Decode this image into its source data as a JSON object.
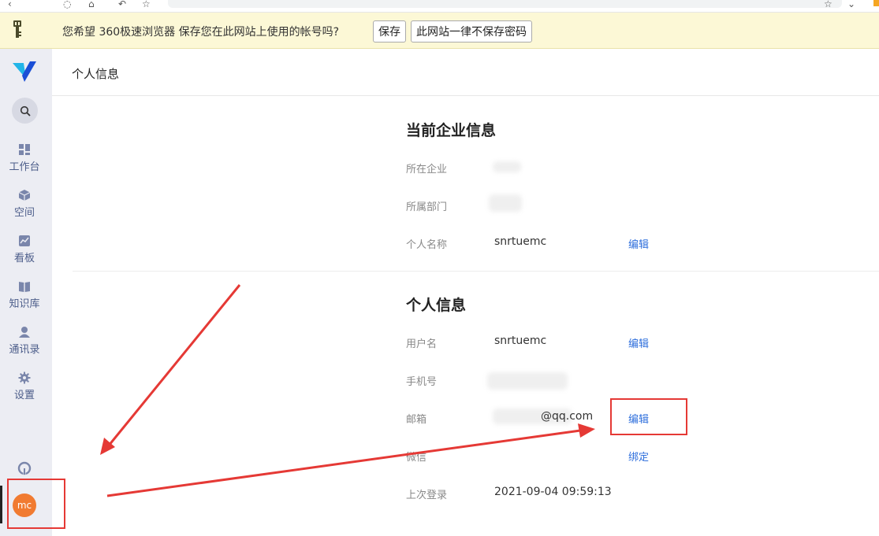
{
  "password_bar": {
    "message": "您希望 360极速浏览器 保存您在此网站上使用的帐号吗?",
    "save_label": "保存",
    "never_label": "此网站一律不保存密码"
  },
  "sidebar": {
    "items": [
      {
        "label": "工作台",
        "icon": "dashboard-icon"
      },
      {
        "label": "空间",
        "icon": "cube-icon"
      },
      {
        "label": "看板",
        "icon": "chart-board-icon"
      },
      {
        "label": "知识库",
        "icon": "book-icon"
      },
      {
        "label": "通讯录",
        "icon": "contacts-icon"
      },
      {
        "label": "设置",
        "icon": "gear-icon"
      }
    ],
    "avatar_text": "mc"
  },
  "header": {
    "title": "个人信息"
  },
  "company_section": {
    "title": "当前企业信息",
    "fields": [
      {
        "label": "所在企业",
        "value": ""
      },
      {
        "label": "所属部门",
        "value": ""
      },
      {
        "label": "个人名称",
        "value": "snrtuemc",
        "action": "编辑"
      }
    ]
  },
  "personal_section": {
    "title": "个人信息",
    "fields": [
      {
        "label": "用户名",
        "value": "snrtuemc",
        "action": "编辑"
      },
      {
        "label": "手机号",
        "value": ""
      },
      {
        "label": "邮箱",
        "value": "@qq.com",
        "action": "编辑"
      },
      {
        "label": "微信",
        "value": "",
        "action": "绑定"
      },
      {
        "label": "上次登录",
        "value": "2021-09-04 09:59:13"
      }
    ]
  },
  "colors": {
    "accent_link": "#2f6fdc",
    "sidebar_bg": "#ecedf3",
    "annotation_red": "#e53935",
    "avatar_bg": "#f17b31"
  }
}
